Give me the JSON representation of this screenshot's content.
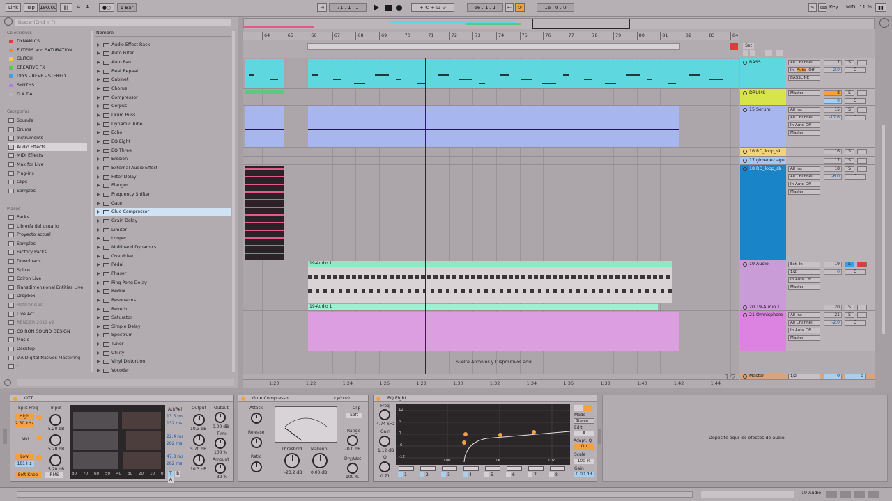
{
  "transport": {
    "link": "Link",
    "tap": "Tap",
    "tempo": "190.00",
    "signature_num": "4",
    "signature_den": "4",
    "quantize": "1 Bar",
    "arrangement_pos": "71 .  1 .  1",
    "loop_start": "66 .  1 .  1",
    "loop_length": "16 .  0 .  0",
    "key": "Key",
    "midi": "MIDI",
    "cpu": "11 %"
  },
  "browser": {
    "search_placeholder": "Buscar (Cmd + F)",
    "collections_title": "Colecciones",
    "collections": [
      {
        "label": "DYNAMICS",
        "color": "#e0393a"
      },
      {
        "label": "FILTERS and SATURATION",
        "color": "#f08a2c"
      },
      {
        "label": "GLITCH",
        "color": "#f2d035"
      },
      {
        "label": "CREATIVE FX",
        "color": "#5cc94c"
      },
      {
        "label": "DLYS - REVB - STEREO",
        "color": "#3c9ee8"
      },
      {
        "label": "SYNTHS",
        "color": "#b07de0"
      },
      {
        "label": "D.A.T.A",
        "color": "#b9b3b7"
      }
    ],
    "categories_title": "Categorías",
    "categories": [
      "Sounds",
      "Drums",
      "Instruments",
      "Audio Effects",
      "MIDI Effects",
      "Max for Live",
      "Plug-ins",
      "Clips",
      "Samples"
    ],
    "selected_category": "Audio Effects",
    "places_title": "Places",
    "places": [
      "Packs",
      "Librería del usuario",
      "Proyecto actual",
      "Samples",
      "Factory Packs",
      "Downloads",
      "Splice",
      "Coiron Live",
      "Transdimensional Entities Live",
      "Dropbox",
      "Referencias",
      "Live Act",
      "RENDER 2019 v2",
      "COIRON SOUND DESIGN",
      "Music",
      "Desktop",
      "V.A Digital Natives Mastering",
      "c"
    ],
    "name_header": "Nombre",
    "items": [
      "Audio Effect Rack",
      "Auto Filter",
      "Auto Pan",
      "Beat Repeat",
      "Cabinet",
      "Chorus",
      "Compressor",
      "Corpus",
      "Drum Buss",
      "Dynamic Tube",
      "Echo",
      "EQ Eight",
      "EQ Three",
      "Erosion",
      "External Audio Effect",
      "Filter Delay",
      "Flanger",
      "Frequency Shifter",
      "Gate",
      "Glue Compressor",
      "Grain Delay",
      "Limiter",
      "Looper",
      "Multiband Dynamics",
      "Overdrive",
      "Pedal",
      "Phaser",
      "Ping Pong Delay",
      "Redux",
      "Resonators",
      "Reverb",
      "Saturator",
      "Simple Delay",
      "Spectrum",
      "Tuner",
      "Utility",
      "Vinyl Distortion",
      "Vocoder"
    ],
    "selected_item": "Glue Compressor"
  },
  "ruler": {
    "bars": [
      "64",
      "65",
      "66",
      "67",
      "68",
      "69",
      "70",
      "71",
      "72",
      "73",
      "74",
      "75",
      "76",
      "77",
      "78",
      "79",
      "80",
      "81",
      "82",
      "83",
      "84"
    ],
    "times": [
      "1:20",
      "1:22",
      "1:24",
      "1:26",
      "1:28",
      "1:30",
      "1:32",
      "1:34",
      "1:36",
      "1:38",
      "1:40",
      "1:42",
      "1:44"
    ],
    "set_label": "Set"
  },
  "tracks": [
    {
      "name": "BASS",
      "color": "#5ed8de",
      "input": "All Channel",
      "monitor_in": "In",
      "monitor_auto": "Auto",
      "monitor_off": "Off",
      "output": "BASSLINE",
      "number": "7",
      "vol": "-2.0",
      "pan": "C"
    },
    {
      "name": "DRUMS",
      "color": "#d7e54a",
      "output": "Master",
      "number": "8",
      "vol": "0",
      "pan": "C"
    },
    {
      "name": "15 Serum",
      "color": "#a8b6f0",
      "input": "All Ins",
      "input2": "All Channel",
      "output": "Master",
      "number": "15",
      "vol": "-17.6",
      "pan": "C"
    },
    {
      "name": "16 RD_loop_sk",
      "color": "#f0d37a",
      "number": "16"
    },
    {
      "name": "17 gimenez agu",
      "color": "#a9c6f0",
      "number": "17"
    },
    {
      "name": "18 RD_loop_sb",
      "color": "#1a84c8",
      "input": "All Ins",
      "input2": "All Channel",
      "output": "Master",
      "number": "18",
      "vol": "-6.0",
      "pan": "C"
    },
    {
      "name": "19 Audio",
      "color": "#c99cd8",
      "input": "Ext. In",
      "input2": "1/2",
      "output": "Master",
      "number": "19",
      "vol": "0",
      "pan": "C"
    },
    {
      "name": "20 19-Audio 1",
      "color": "#c99cd8",
      "number": "20"
    },
    {
      "name": "21 Omnisphere",
      "color": "#dc82e0",
      "input": "All Ins",
      "input2": "All Channel",
      "output": "Master",
      "number": "21",
      "vol": "-2.0",
      "pan": "C"
    }
  ],
  "master": {
    "name": "Master",
    "output": "1/2",
    "vol": "0",
    "pan": "0",
    "page": "1/2"
  },
  "clips": {
    "audio_clip_1": "19-Audio 1",
    "audio_clip_2": "19-Audio 1",
    "drop_hint": "Suelte Archivos y Dispositivos aquí"
  },
  "ott": {
    "title": "OTT",
    "split_freq": "Split Freq",
    "input": "Input",
    "high": "High",
    "high_freq": "2.50 kHz",
    "mid": "Mid",
    "low": "Low",
    "low_freq": "181 Hz",
    "in_high": "5.20 dB",
    "in_mid": "5.20 dB",
    "in_low": "5.20 dB",
    "soft_knee": "Soft Knee",
    "rms": "RMS",
    "att_rel": "Att/Rel",
    "att_high": "13.5 ms",
    "rel_high": "132 ms",
    "att_mid": "22.4 ms",
    "rel_mid": "282 ms",
    "att_low": "47.8 ms",
    "rel_low": "282 ms",
    "output": "Output",
    "out_high": "10.3 dB",
    "out_mid": "5.70 dB",
    "out_low": "10.3 dB",
    "output2": "Output",
    "out_val": "0.00 dB",
    "time": "Time",
    "time_val": "100 %",
    "amount": "Amount",
    "amount_val": "39 %",
    "scale": [
      "80",
      "70",
      "60",
      "50",
      "40",
      "30",
      "20",
      "10",
      "0"
    ],
    "t": "T",
    "b": "B",
    "a": "A"
  },
  "glue": {
    "title": "Glue Compressor",
    "brand": "cytomic",
    "attack": "Attack",
    "release": "Release",
    "ratio": "Ratio",
    "clip": "Clip",
    "soft": "Soft",
    "threshold": "Threshold",
    "threshold_val": "-23.2 dB",
    "makeup": "Makeup",
    "makeup_val": "0.00 dB",
    "range": "Range",
    "range_val": "70.0 dB",
    "drywet": "Dry/Wet",
    "drywet_val": "100 %"
  },
  "eq": {
    "title": "EQ Eight",
    "freq": "Freq",
    "freq_val": "4.74 kHz",
    "gain": "Gain",
    "gain_val": "1.12 dB",
    "q": "Q",
    "q_val": "0.71",
    "db_labels": [
      "12",
      "6",
      "0",
      "-6",
      "-12"
    ],
    "freq_labels": [
      "100",
      "1k",
      "10k"
    ],
    "mode": "Mode",
    "mode_val": "Stereo",
    "edit": "Edit",
    "edit_val": "A",
    "adapt_q": "Adapt. Q",
    "adapt_val": "On",
    "scale": "Scale",
    "scale_val": "100 %",
    "gain2": "Gain",
    "gain2_val": "0.00 dB",
    "bands": [
      "1",
      "2",
      "3",
      "4",
      "5",
      "6",
      "7",
      "8"
    ]
  },
  "drop_audio_fx": "Deposite aquí los efectos de audio",
  "status": {
    "track": "19-Audio"
  }
}
